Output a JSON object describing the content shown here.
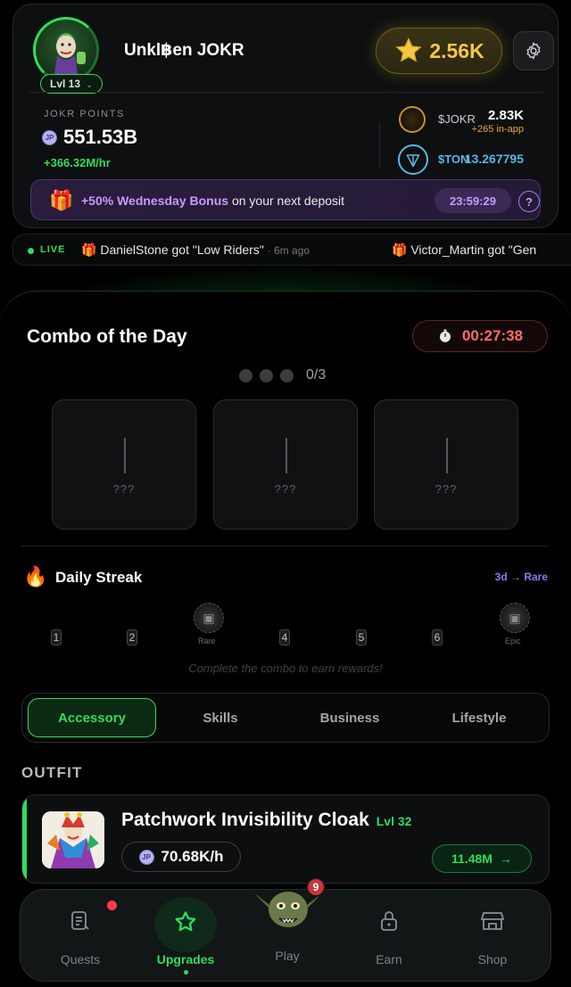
{
  "profile": {
    "username": "Unkl฿en JOKR",
    "level": "Lvl 13",
    "stars": "2.56K"
  },
  "points": {
    "label": "JOKR POINTS",
    "value": "551.53B",
    "rate": "+366.32M/hr",
    "coin_symbol": "JP"
  },
  "balances": {
    "jokr_label": "$JOKR",
    "jokr_value": "2.83K",
    "jokr_sub": "+265 in-app",
    "ton_label": "$TON",
    "ton_value": "13.267795"
  },
  "bonus": {
    "highlight": "+50% Wednesday Bonus",
    "rest": " on your next deposit",
    "timer": "23:59:29",
    "help": "?"
  },
  "ticker": {
    "live": "LIVE",
    "items": [
      {
        "text": "DanielStone got \"Low Riders\"",
        "time": "· 6m ago"
      },
      {
        "text": "Victor_Martin got \"Gen"
      }
    ]
  },
  "combo": {
    "title": "Combo of the Day",
    "timer": "00:27:38",
    "progress": "0/3",
    "slots": [
      "???",
      "???",
      "???"
    ]
  },
  "streak": {
    "title": "Daily Streak",
    "hint": "3d → Rare",
    "days": [
      "1",
      "2",
      "4",
      "5",
      "6"
    ],
    "chest_labels": [
      "Rare",
      "Epic"
    ],
    "note": "Complete the combo to earn rewards!"
  },
  "tabs": [
    "Accessory",
    "Skills",
    "Business",
    "Lifestyle"
  ],
  "section_title": "OUTFIT",
  "upgrade": {
    "name": "Patchwork Invisibility Cloak",
    "level": "Lvl 32",
    "rate": "70.68K/h",
    "cost": "11.48M"
  },
  "nav": {
    "items": [
      "Quests",
      "Upgrades",
      "Play",
      "Earn",
      "Shop"
    ],
    "play_badge": "9"
  },
  "colors": {
    "accent": "#2fdc5b",
    "gold": "#f5c844",
    "purple": "#c79bff",
    "ton": "#59b6e6",
    "red": "#ff6b6b"
  }
}
